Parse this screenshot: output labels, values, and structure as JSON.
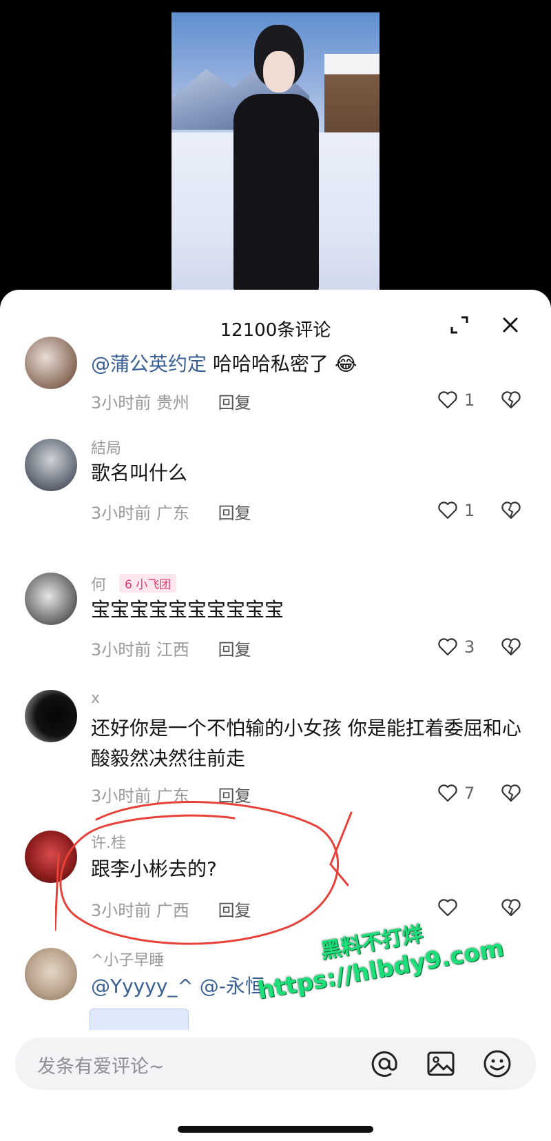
{
  "header": {
    "title": "12100条评论"
  },
  "comments": [
    {
      "username": "",
      "mention": "@蒲公英约定",
      "text": " 哈哈哈私密了",
      "emoji": "😂",
      "time": "3小时前",
      "location": "贵州",
      "reply": "回复",
      "likes": "1"
    },
    {
      "username": "結局",
      "text": "歌名叫什么",
      "time": "3小时前",
      "location": "广东",
      "reply": "回复",
      "likes": "1"
    },
    {
      "username": "何",
      "badge": "6 小飞团",
      "text": "宝宝宝宝宝宝宝宝宝宝",
      "time": "3小时前",
      "location": "江西",
      "reply": "回复",
      "likes": "3"
    },
    {
      "username": "x",
      "text": "还好你是一个不怕输的小女孩 你是能扛着委屈和心酸毅然决然往前走",
      "time": "3小时前",
      "location": "广东",
      "reply": "回复",
      "likes": "7"
    },
    {
      "username": "许.桂",
      "text": "跟李小彬去的?",
      "time": "3小时前",
      "location": "广西",
      "reply": "回复",
      "likes": ""
    },
    {
      "username": "^小子早睡",
      "text": "@Yyyyy_^ @-永恒",
      "time": "",
      "location": "",
      "reply": "",
      "likes": ""
    }
  ],
  "input": {
    "placeholder": "发条有爱评论~"
  },
  "watermark": {
    "line1": "黑料不打烊",
    "line2": "https://hlbdy9.com"
  },
  "colors": {
    "mention": "#3a5f94",
    "annotation": "#e8413a",
    "watermark": "#1be07a"
  }
}
